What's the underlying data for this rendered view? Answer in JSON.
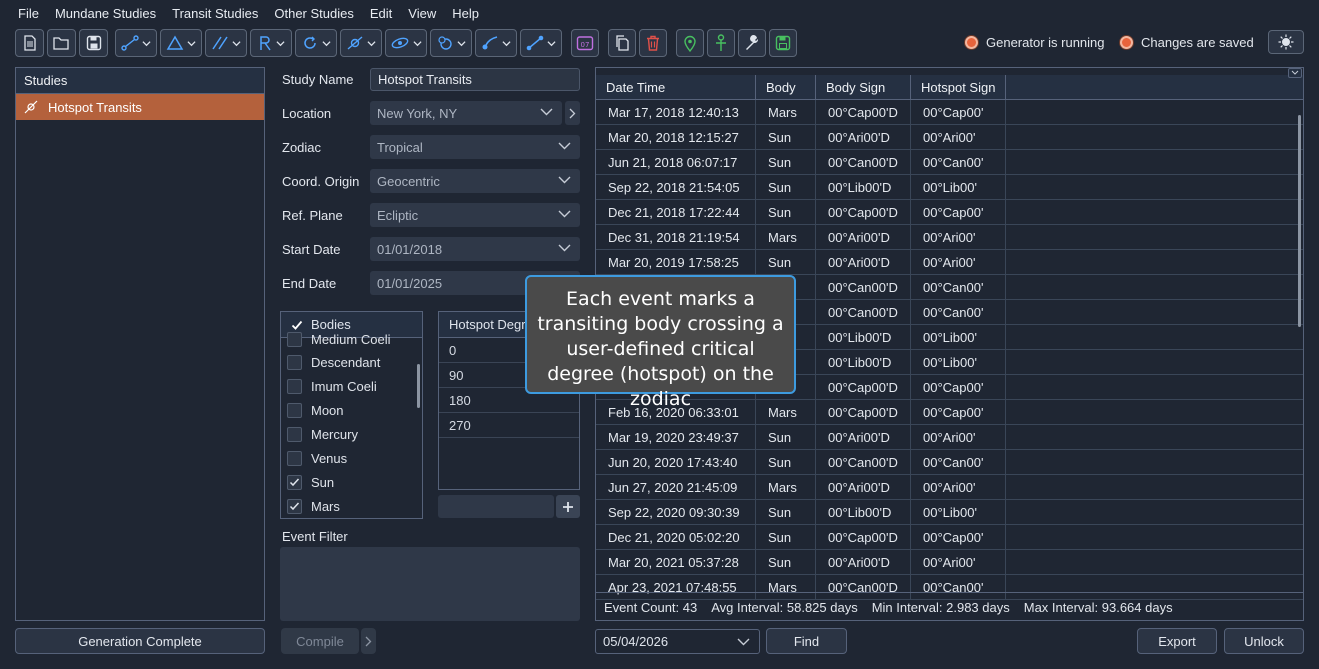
{
  "menubar": [
    "File",
    "Mundane Studies",
    "Transit Studies",
    "Other Studies",
    "Edit",
    "View",
    "Help"
  ],
  "toolbar": {
    "icons": [
      "new-file-icon",
      "open-folder-icon",
      "save-icon",
      "aspect-lines-icon",
      "triangle-icon",
      "parallel-lines-icon",
      "retrograde-r-icon",
      "cycle-icon",
      "hotspot-icon",
      "orbit-icon",
      "eclipse-icon",
      "curve-icon",
      "line-points-icon",
      "calendar-icon",
      "copy-icon",
      "delete-icon",
      "location-pin-icon",
      "figure-icon",
      "wrench-icon",
      "save-green-icon",
      "settings-icon"
    ],
    "calendar_label": "07"
  },
  "status": {
    "generator": "Generator is running",
    "changes": "Changes are saved"
  },
  "studies": {
    "header": "Studies",
    "items": [
      "Hotspot Transits"
    ],
    "generation_button": "Generation Complete"
  },
  "form": {
    "study_name_label": "Study Name",
    "study_name_value": "Hotspot Transits",
    "location_label": "Location",
    "location_value": "New York, NY",
    "zodiac_label": "Zodiac",
    "zodiac_value": "Tropical",
    "coord_label": "Coord. Origin",
    "coord_value": "Geocentric",
    "refplane_label": "Ref. Plane",
    "refplane_value": "Ecliptic",
    "start_label": "Start Date",
    "start_value": "01/01/2018",
    "end_label": "End Date",
    "end_value": "01/01/2025"
  },
  "bodies": {
    "header": "Bodies",
    "items": [
      {
        "label": "Medium Coeli",
        "checked": false
      },
      {
        "label": "Descendant",
        "checked": false
      },
      {
        "label": "Imum Coeli",
        "checked": false
      },
      {
        "label": "Moon",
        "checked": false
      },
      {
        "label": "Mercury",
        "checked": false
      },
      {
        "label": "Venus",
        "checked": false
      },
      {
        "label": "Sun",
        "checked": true
      },
      {
        "label": "Mars",
        "checked": true
      }
    ]
  },
  "hotspots": {
    "header": "Hotspot Degr",
    "values": [
      "0",
      "90",
      "180",
      "270"
    ]
  },
  "event_filter": {
    "label": "Event Filter"
  },
  "compile_label": "Compile",
  "table": {
    "columns": [
      "Date Time",
      "Body",
      "Body Sign",
      "Hotspot Sign"
    ],
    "rows": [
      [
        "Mar 17, 2018 12:40:13",
        "Mars",
        "00°Cap00'D",
        "00°Cap00'"
      ],
      [
        "Mar 20, 2018 12:15:27",
        "Sun",
        "00°Ari00'D",
        "00°Ari00'"
      ],
      [
        "Jun 21, 2018 06:07:17",
        "Sun",
        "00°Can00'D",
        "00°Can00'"
      ],
      [
        "Sep 22, 2018 21:54:05",
        "Sun",
        "00°Lib00'D",
        "00°Lib00'"
      ],
      [
        "Dec 21, 2018 17:22:44",
        "Sun",
        "00°Cap00'D",
        "00°Cap00'"
      ],
      [
        "Dec 31, 2018 21:19:54",
        "Mars",
        "00°Ari00'D",
        "00°Ari00'"
      ],
      [
        "Mar 20, 2019 17:58:25",
        "Sun",
        "00°Ari00'D",
        "00°Ari00'"
      ],
      [
        "",
        "",
        "00°Can00'D",
        "00°Can00'"
      ],
      [
        "",
        "",
        "00°Can00'D",
        "00°Can00'"
      ],
      [
        "",
        "",
        "00°Lib00'D",
        "00°Lib00'"
      ],
      [
        "",
        "",
        "00°Lib00'D",
        "00°Lib00'"
      ],
      [
        "",
        "",
        "00°Cap00'D",
        "00°Cap00'"
      ],
      [
        "Feb 16, 2020 06:33:01",
        "Mars",
        "00°Cap00'D",
        "00°Cap00'"
      ],
      [
        "Mar 19, 2020 23:49:37",
        "Sun",
        "00°Ari00'D",
        "00°Ari00'"
      ],
      [
        "Jun 20, 2020 17:43:40",
        "Sun",
        "00°Can00'D",
        "00°Can00'"
      ],
      [
        "Jun 27, 2020 21:45:09",
        "Mars",
        "00°Ari00'D",
        "00°Ari00'"
      ],
      [
        "Sep 22, 2020 09:30:39",
        "Sun",
        "00°Lib00'D",
        "00°Lib00'"
      ],
      [
        "Dec 21, 2020 05:02:20",
        "Sun",
        "00°Cap00'D",
        "00°Cap00'"
      ],
      [
        "Mar 20, 2021 05:37:28",
        "Sun",
        "00°Ari00'D",
        "00°Ari00'"
      ],
      [
        "Apr 23, 2021 07:48:55",
        "Mars",
        "00°Can00'D",
        "00°Can00'"
      ]
    ]
  },
  "summary": {
    "count": "Event Count:  43",
    "avg": "Avg Interval:  58.825 days",
    "min": "Min Interval:  2.983 days",
    "max": "Max Interval:  93.664 days"
  },
  "bottom": {
    "date_value": "05/04/2026",
    "find": "Find",
    "export": "Export",
    "unlock": "Unlock"
  },
  "tooltip": "Each event marks a transiting body crossing a user-defined critical degree (hotspot) on the zodiac",
  "colors": {
    "accent": "#b4613c",
    "led": "#e8633c",
    "tooltip_border": "#3d9be0"
  }
}
